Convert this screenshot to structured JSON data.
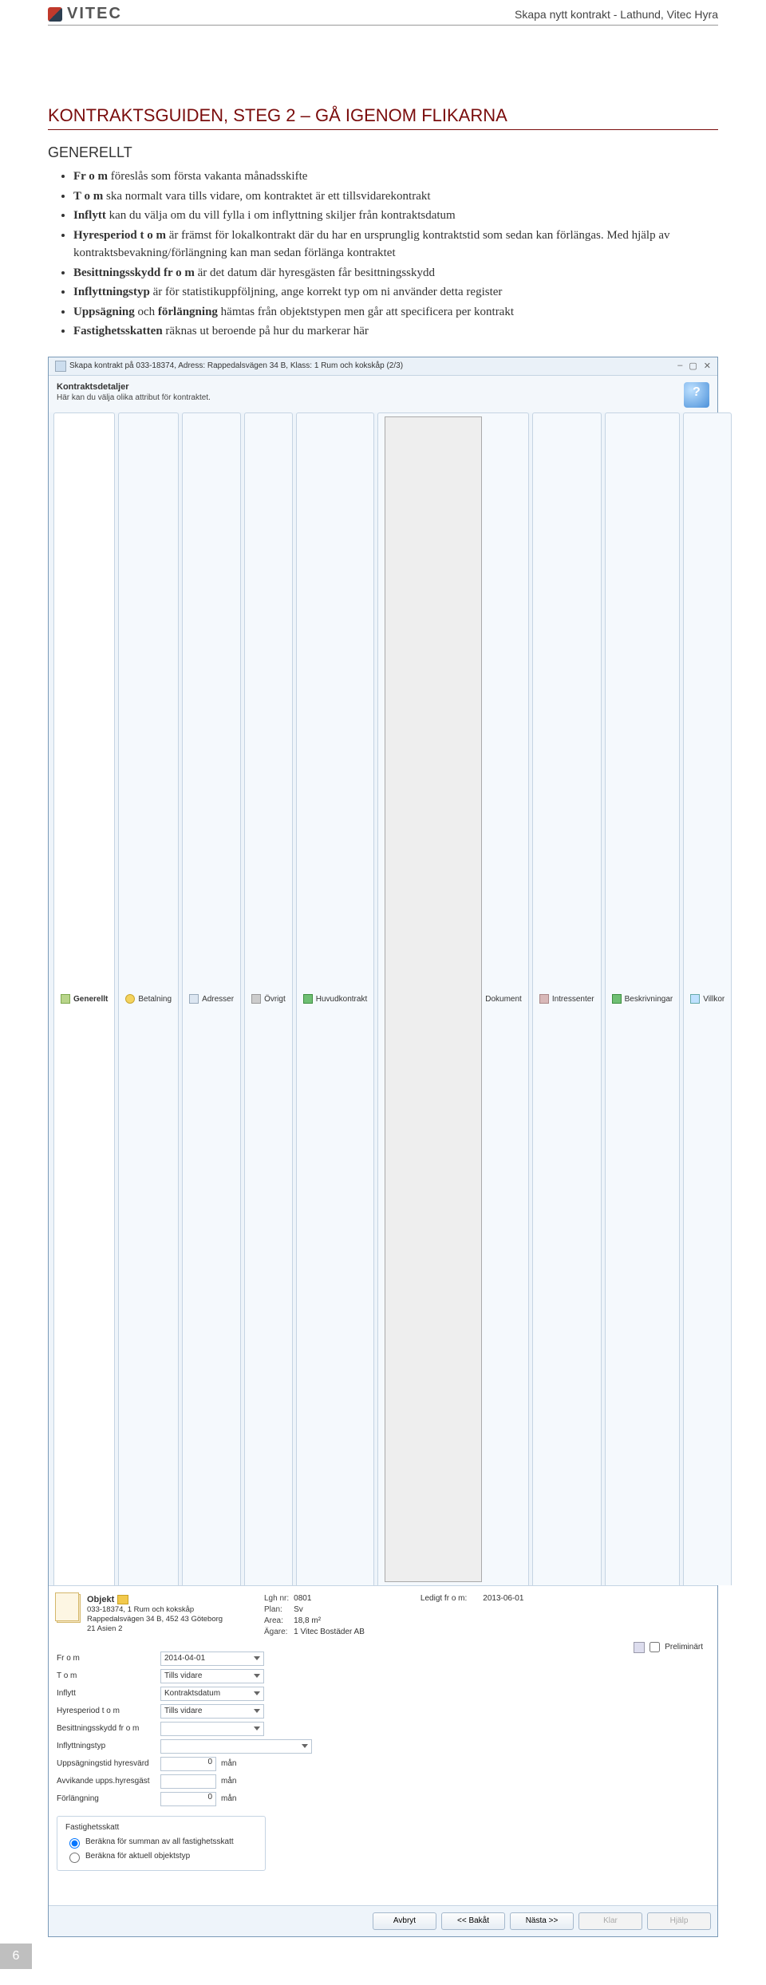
{
  "header": {
    "logo_text": "VITEC",
    "doc_title": "Skapa nytt kontrakt - Lathund, Vitec Hyra"
  },
  "section_heading": "KONTRAKTSGUIDEN, STEG 2 – GÅ IGENOM FLIKARNA",
  "sub_heading": "GENERELLT",
  "bullets": [
    {
      "b": "Fr o m",
      "rest": " föreslås som första vakanta månadsskifte"
    },
    {
      "b": "T o m",
      "rest": " ska normalt vara tills vidare, om kontraktet är ett tillsvidarekontrakt"
    },
    {
      "b": "Inflytt",
      "rest": " kan du välja om du vill fylla i om inflyttning skiljer från kontraktsdatum"
    },
    {
      "b": "Hyresperiod t o m",
      "rest": " är främst för lokalkontrakt där du har en ursprunglig kontraktstid som sedan kan förlängas. Med hjälp av kontraktsbevakning/förlängning kan man sedan förlänga kontraktet"
    },
    {
      "b": "Besittningsskydd fr o m",
      "rest": " är det datum där hyresgästen får besittningsskydd"
    },
    {
      "b": "Inflyttningstyp",
      "rest": " är för statistikuppföljning, ange korrekt typ om ni använder detta register"
    },
    {
      "b": "Uppsägning",
      "rest_before": " och ",
      "b2": "förlängning",
      "rest": " hämtas från objektstypen men går att specificera per kontrakt"
    },
    {
      "b": "Fastighetsskatten",
      "rest": " räknas ut beroende på hur du markerar här"
    }
  ],
  "app": {
    "title": "Skapa kontrakt på 033-18374, Adress: Rappedalsvägen 34 B, Klass: 1 Rum och kokskåp (2/3)",
    "panel_title": "Kontraktsdetaljer",
    "panel_subtitle": "Här kan du välja olika attribut för kontraktet.",
    "tabs": [
      {
        "label": "Generellt",
        "icon": "doc",
        "active": true
      },
      {
        "label": "Betalning",
        "icon": "money"
      },
      {
        "label": "Adresser",
        "icon": "mail"
      },
      {
        "label": "Övrigt",
        "icon": "gear"
      },
      {
        "label": "Huvudkontrakt",
        "icon": "tree"
      },
      {
        "label": "Dokument",
        "icon": "page"
      },
      {
        "label": "Intressenter",
        "icon": "person"
      },
      {
        "label": "Beskrivningar",
        "icon": "tree"
      },
      {
        "label": "Villkor",
        "icon": "check"
      }
    ],
    "obj": {
      "heading": "Objekt",
      "line1": "033-18374, 1 Rum och kokskåp",
      "line2": "Rappedalsvägen 34 B, 452 43 Göteborg",
      "line3": "21 Asien 2",
      "kvlabels": [
        "Lgh nr:",
        "Plan:",
        "Area:",
        "Ägare:"
      ],
      "kvvalues": [
        "0801",
        "Sv",
        "18,8 m²",
        "1 Vitec Bostäder AB"
      ],
      "ledigt_label": "Ledigt fr o m:",
      "ledigt_value": "2013-06-01"
    },
    "form": {
      "rows": [
        {
          "label": "Fr o m",
          "value": "2014-04-01",
          "type": "dropdown"
        },
        {
          "label": "T o m",
          "value": "Tills vidare",
          "type": "dropdown"
        },
        {
          "label": "Inflytt",
          "value": "Kontraktsdatum",
          "type": "dropdown"
        },
        {
          "label": "Hyresperiod t o m",
          "value": "Tills vidare",
          "type": "dropdown"
        },
        {
          "label": "Besittningsskydd fr o m",
          "value": "",
          "type": "dropdown"
        },
        {
          "label": "Inflyttningstyp",
          "value": "",
          "type": "dropdown-wide"
        },
        {
          "label": "Uppsägningstid hyresvärd",
          "value": "0",
          "unit": "mån",
          "type": "num"
        },
        {
          "label": "Avvikande upps.hyresgäst",
          "value": "",
          "unit": "mån",
          "type": "num"
        },
        {
          "label": "Förlängning",
          "value": "0",
          "unit": "mån",
          "type": "num"
        }
      ],
      "preliminart": "Preliminärt",
      "fastighet_legend": "Fastighetsskatt",
      "fastighet_opts": [
        "Beräkna för summan av all fastighetsskatt",
        "Beräkna för aktuell objektstyp"
      ]
    },
    "buttons": {
      "avbryt": "Avbryt",
      "bakat": "<< Bakåt",
      "nasta": "Nästa >>",
      "klar": "Klar",
      "hjalp": "Hjälp"
    }
  },
  "page_number": "6"
}
